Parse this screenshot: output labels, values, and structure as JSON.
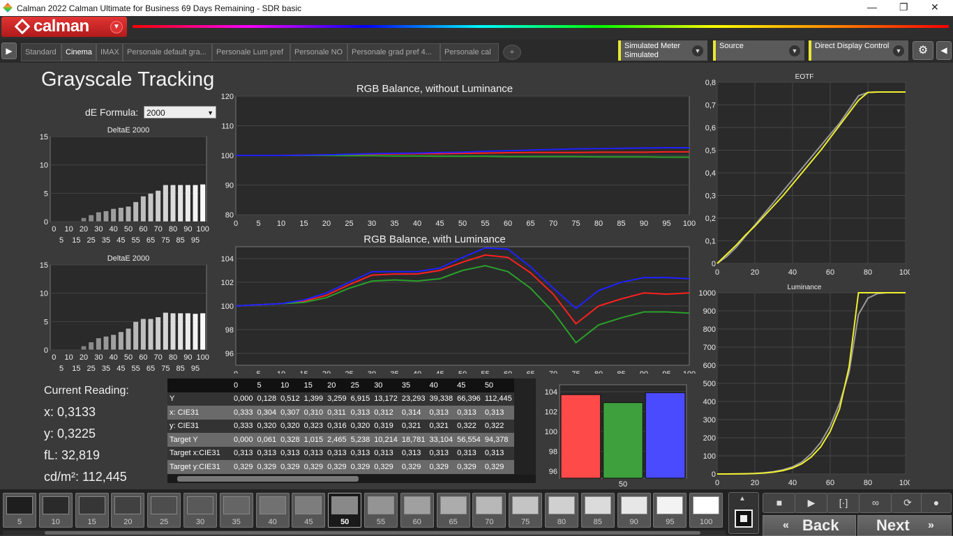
{
  "window": {
    "title": "Calman 2022 Calman Ultimate for Business 69 Days Remaining  - SDR basic",
    "minimize": "—",
    "maximize": "❐",
    "close": "✕"
  },
  "logo": {
    "text": "calman"
  },
  "tabs": [
    "Standard",
    "Cinema",
    "IMAX",
    "Personale default gra...",
    "Personale Lum pref",
    "Personale NO",
    "Personale grad pref 4...",
    "Personale cal",
    "+"
  ],
  "active_tab": "Cinema",
  "selectors": {
    "meter_line1": "Simulated Meter",
    "meter_line2": "Simulated",
    "source": "Source",
    "display": "Direct Display Control"
  },
  "page_title": "Grayscale Tracking",
  "de_formula": {
    "label": "dE Formula:",
    "value": "2000"
  },
  "current_reading": {
    "label": "Current Reading:",
    "x": "x: 0,3133",
    "y": "y: 0,3225",
    "fl": "fL: 32,819",
    "cdm2": "cd/m²: 112,445"
  },
  "table": {
    "headers": [
      "",
      "0",
      "5",
      "10",
      "15",
      "20",
      "25",
      "30",
      "35",
      "40",
      "45",
      "50"
    ],
    "rows": [
      {
        "label": "Y",
        "values": [
          "0,000",
          "0,128",
          "0,512",
          "1,399",
          "3,259",
          "6,915",
          "13,172",
          "23,293",
          "39,338",
          "66,396",
          "112,445"
        ]
      },
      {
        "label": "x: CIE31",
        "values": [
          "0,333",
          "0,304",
          "0,307",
          "0,310",
          "0,311",
          "0,313",
          "0,312",
          "0,314",
          "0,313",
          "0,313",
          "0,313"
        ]
      },
      {
        "label": "y: CIE31",
        "values": [
          "0,333",
          "0,320",
          "0,320",
          "0,323",
          "0,316",
          "0,320",
          "0,319",
          "0,321",
          "0,321",
          "0,322",
          "0,322"
        ]
      },
      {
        "label": "Target Y",
        "values": [
          "0,000",
          "0,061",
          "0,328",
          "1,015",
          "2,465",
          "5,238",
          "10,214",
          "18,781",
          "33,104",
          "56,554",
          "94,378"
        ]
      },
      {
        "label": "Target x:CIE31",
        "values": [
          "0,313",
          "0,313",
          "0,313",
          "0,313",
          "0,313",
          "0,313",
          "0,313",
          "0,313",
          "0,313",
          "0,313",
          "0,313"
        ]
      },
      {
        "label": "Target y:CIE31",
        "values": [
          "0,329",
          "0,329",
          "0,329",
          "0,329",
          "0,329",
          "0,329",
          "0,329",
          "0,329",
          "0,329",
          "0,329",
          "0,329"
        ]
      }
    ]
  },
  "swatches": [
    "5",
    "10",
    "15",
    "20",
    "25",
    "30",
    "35",
    "40",
    "45",
    "50",
    "55",
    "60",
    "65",
    "70",
    "75",
    "80",
    "85",
    "90",
    "95",
    "100"
  ],
  "active_swatch": "50",
  "nav": {
    "back": "Back",
    "next": "Next"
  },
  "chart_data": [
    {
      "id": "de1",
      "type": "bar",
      "title": "DeltaE 2000",
      "x": [
        0,
        5,
        10,
        15,
        20,
        25,
        30,
        35,
        40,
        45,
        50,
        55,
        60,
        65,
        70,
        75,
        80,
        85,
        90,
        95,
        100
      ],
      "values": [
        0,
        0,
        0,
        0,
        0.7,
        1.2,
        1.7,
        1.9,
        2.3,
        2.5,
        2.7,
        3.5,
        4.5,
        5.0,
        5.5,
        6.5,
        6.5,
        6.5,
        6.5,
        6.5,
        6.6
      ],
      "ylim": [
        0,
        15
      ],
      "yticks": [
        0,
        5,
        10,
        15
      ],
      "xticks_top": [
        "0",
        "10",
        "20",
        "30",
        "40",
        "50",
        "60",
        "70",
        "80",
        "90",
        "100"
      ],
      "xticks_bottom": [
        "5",
        "15",
        "25",
        "35",
        "45",
        "55",
        "65",
        "75",
        "85",
        "95"
      ]
    },
    {
      "id": "de2",
      "type": "bar",
      "title": "DeltaE 2000",
      "x": [
        0,
        5,
        10,
        15,
        20,
        25,
        30,
        35,
        40,
        45,
        50,
        55,
        60,
        65,
        70,
        75,
        80,
        85,
        90,
        95,
        100
      ],
      "values": [
        0,
        0,
        0,
        0,
        0.7,
        1.4,
        2.1,
        2.4,
        2.7,
        3.2,
        3.8,
        5.0,
        5.5,
        5.5,
        5.8,
        6.6,
        6.5,
        6.5,
        6.5,
        6.4,
        6.5
      ],
      "ylim": [
        0,
        15
      ],
      "yticks": [
        0,
        5,
        10,
        15
      ],
      "xticks_top": [
        "0",
        "10",
        "20",
        "30",
        "40",
        "50",
        "60",
        "70",
        "80",
        "90",
        "100"
      ],
      "xticks_bottom": [
        "5",
        "15",
        "25",
        "35",
        "45",
        "55",
        "65",
        "75",
        "85",
        "95"
      ]
    },
    {
      "id": "rgb1",
      "type": "line",
      "title": "RGB Balance, without Luminance",
      "x": [
        0,
        5,
        10,
        15,
        20,
        25,
        30,
        35,
        40,
        45,
        50,
        55,
        60,
        65,
        70,
        75,
        80,
        85,
        90,
        95,
        100
      ],
      "ylim": [
        80,
        120
      ],
      "yticks": [
        80,
        90,
        100,
        110,
        120
      ],
      "series": [
        {
          "color": "#ff2020",
          "values": [
            100,
            100,
            100,
            100.1,
            100.2,
            100.3,
            100.4,
            100.5,
            100.6,
            100.6,
            100.7,
            100.8,
            100.9,
            101,
            101,
            101,
            101.1,
            101.1,
            101.1,
            101.2,
            101.2
          ]
        },
        {
          "color": "#2aa02a",
          "values": [
            100,
            100,
            100,
            100,
            100,
            99.9,
            99.9,
            99.8,
            99.8,
            99.7,
            99.7,
            99.7,
            99.6,
            99.6,
            99.6,
            99.6,
            99.5,
            99.5,
            99.5,
            99.4,
            99.4
          ]
        },
        {
          "color": "#2020ff",
          "values": [
            100,
            100,
            100,
            100.1,
            100.2,
            100.4,
            100.6,
            100.7,
            100.8,
            101,
            101.1,
            101.4,
            101.6,
            101.8,
            102,
            102.2,
            102.3,
            102.4,
            102.5,
            102.6,
            102.6
          ]
        }
      ]
    },
    {
      "id": "rgb2",
      "type": "line",
      "title": "RGB Balance, with Luminance",
      "x": [
        0,
        5,
        10,
        15,
        20,
        25,
        30,
        35,
        40,
        45,
        50,
        55,
        60,
        65,
        70,
        75,
        80,
        85,
        90,
        95,
        100
      ],
      "ylim": [
        95,
        105
      ],
      "yticks": [
        96,
        98,
        100,
        102,
        104
      ],
      "series": [
        {
          "color": "#ff2020",
          "values": [
            100,
            100.1,
            100.2,
            100.4,
            100.9,
            101.8,
            102.6,
            102.7,
            102.7,
            103.0,
            103.7,
            104.3,
            104.1,
            102.8,
            101.0,
            98.5,
            100.0,
            100.6,
            101.1,
            101.0,
            101.1
          ]
        },
        {
          "color": "#2aa02a",
          "values": [
            100,
            100.1,
            100.2,
            100.3,
            100.7,
            101.5,
            102.1,
            102.2,
            102.1,
            102.3,
            103.0,
            103.4,
            102.9,
            101.5,
            99.5,
            96.9,
            98.4,
            99.0,
            99.5,
            99.5,
            99.4
          ]
        },
        {
          "color": "#2020ff",
          "values": [
            100,
            100.1,
            100.2,
            100.5,
            101.1,
            102.0,
            102.9,
            102.9,
            102.9,
            103.2,
            104.1,
            104.9,
            104.8,
            103.3,
            101.5,
            99.8,
            101.3,
            102.0,
            102.4,
            102.4,
            102.3
          ]
        }
      ]
    },
    {
      "id": "eotf",
      "type": "line",
      "title": "EOTF",
      "x": [
        0,
        5,
        10,
        15,
        20,
        25,
        30,
        35,
        40,
        45,
        50,
        55,
        60,
        65,
        70,
        75,
        80,
        85,
        90,
        95,
        100
      ],
      "xlim": [
        0,
        100
      ],
      "ylim": [
        0,
        0.8
      ],
      "xticks": [
        0,
        20,
        40,
        60,
        80,
        100
      ],
      "yticks": [
        "0",
        "0,1",
        "0,2",
        "0,3",
        "0,4",
        "0,5",
        "0,6",
        "0,7",
        "0,8"
      ],
      "series": [
        {
          "color": "#9a9a9a",
          "values": [
            0,
            0.03,
            0.07,
            0.12,
            0.17,
            0.22,
            0.27,
            0.32,
            0.37,
            0.42,
            0.47,
            0.52,
            0.57,
            0.62,
            0.68,
            0.74,
            0.755,
            0.757,
            0.757,
            0.757,
            0.757
          ]
        },
        {
          "color": "#f0f030",
          "values": [
            0,
            0.04,
            0.08,
            0.125,
            0.165,
            0.21,
            0.255,
            0.3,
            0.35,
            0.4,
            0.45,
            0.5,
            0.555,
            0.61,
            0.665,
            0.72,
            0.755,
            0.757,
            0.757,
            0.757,
            0.757
          ]
        }
      ]
    },
    {
      "id": "lum",
      "type": "line",
      "title": "Luminance",
      "x": [
        0,
        5,
        10,
        15,
        20,
        25,
        30,
        35,
        40,
        45,
        50,
        55,
        60,
        65,
        70,
        75,
        80,
        85,
        90,
        95,
        100
      ],
      "xlim": [
        0,
        100
      ],
      "ylim": [
        0,
        1000
      ],
      "xticks": [
        0,
        20,
        40,
        60,
        80,
        100
      ],
      "yticks": [
        0,
        100,
        200,
        300,
        400,
        500,
        600,
        700,
        800,
        900,
        1000
      ],
      "series": [
        {
          "color": "#9a9a9a",
          "values": [
            0,
            0.1,
            0.5,
            1.4,
            3.3,
            6.9,
            13.2,
            23.3,
            39.3,
            66.4,
            112.4,
            175,
            265,
            390,
            560,
            880,
            970,
            995,
            1000,
            1000,
            1000
          ]
        },
        {
          "color": "#f0f030",
          "values": [
            0,
            0.06,
            0.33,
            1.0,
            2.5,
            5.2,
            10.2,
            18.8,
            33.1,
            56.6,
            94.4,
            150,
            235,
            360,
            590,
            1000,
            1000,
            1000,
            1000,
            1000,
            1000
          ]
        }
      ]
    },
    {
      "id": "bars",
      "type": "bar",
      "categories": [
        "R",
        "G",
        "B"
      ],
      "x_label": "50",
      "values": [
        103.7,
        102.9,
        103.9
      ],
      "colors": [
        "#ff4a4a",
        "#3da03d",
        "#4a4aff"
      ],
      "ylim": [
        95.3,
        104.7
      ],
      "yticks": [
        96,
        98,
        100,
        102,
        104
      ]
    }
  ]
}
